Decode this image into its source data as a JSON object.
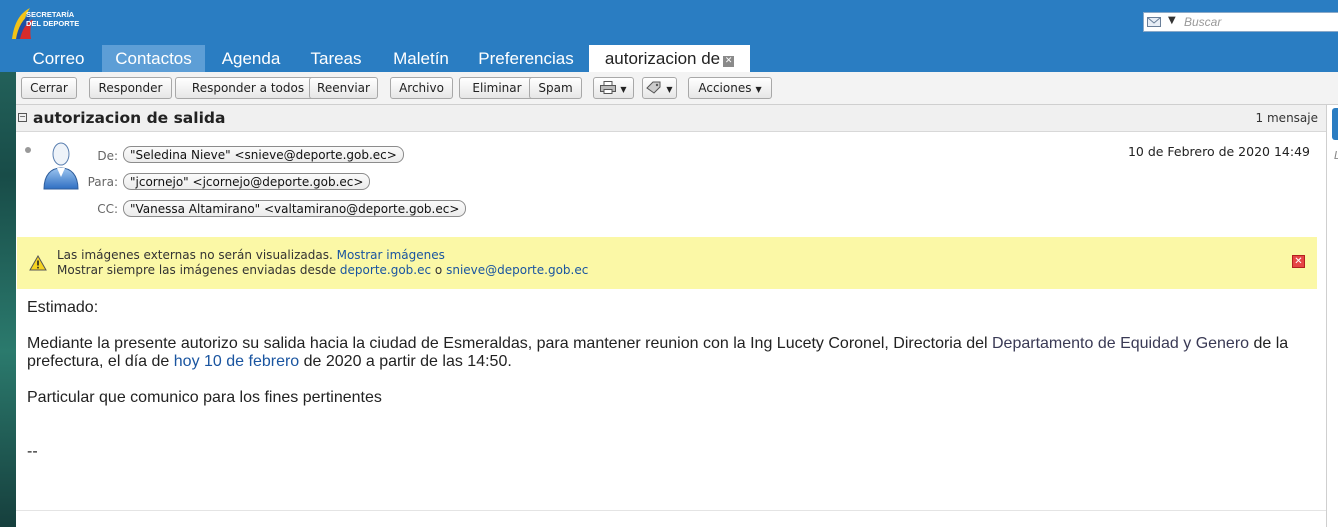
{
  "app": {
    "logo_text_line1": "SECRETARÍA",
    "logo_text_line2": "DEL DEPORTE",
    "search_placeholder": "Buscar"
  },
  "tabs": [
    {
      "label": "Correo"
    },
    {
      "label": "Contactos"
    },
    {
      "label": "Agenda"
    },
    {
      "label": "Tareas"
    },
    {
      "label": "Maletín"
    },
    {
      "label": "Preferencias"
    },
    {
      "label": "autorizacion de"
    }
  ],
  "toolbar": {
    "close": "Cerrar",
    "reply": "Responder",
    "reply_all": "Responder a todos",
    "forward": "Reenviar",
    "archive": "Archivo",
    "delete": "Eliminar",
    "spam": "Spam",
    "actions": "Acciones"
  },
  "conversation": {
    "subject": "autorizacion de salida",
    "count": "1 mensaje"
  },
  "message": {
    "from_label": "De:",
    "from": "\"Seledina Nieve\" <snieve@deporte.gob.ec>",
    "to_label": "Para:",
    "to": "\"jcornejo\" <jcornejo@deporte.gob.ec>",
    "cc_label": "CC:",
    "cc": "\"Vanessa Altamirano\" <valtamirano@deporte.gob.ec>",
    "date": "10 de Febrero de 2020 14:49"
  },
  "warning": {
    "line1_text": "Las imágenes externas no serán visualizadas.",
    "line1_link": "Mostrar imágenes",
    "line2_text": "Mostrar siempre las imágenes enviadas desde",
    "line2_link1": "deporte.gob.ec",
    "line2_or": "o",
    "line2_link2": "snieve@deporte.gob.ec"
  },
  "body": {
    "greeting": "Estimado:",
    "para1_a": "Mediante la presente autorizo su salida hacia la ciudad de Esmeraldas, para mantener reunion con la Ing Lucety Coronel,  Directoria del ",
    "para1_dept": "Departamento de Equidad y Genero",
    "para1_b": " de la prefectura, el día de ",
    "para1_date_link": "hoy 10 de febrero",
    "para1_c": " de 2020 a partir de las 14:50.",
    "para2": "Particular que comunico para los fines pertinentes",
    "signature": "--"
  }
}
